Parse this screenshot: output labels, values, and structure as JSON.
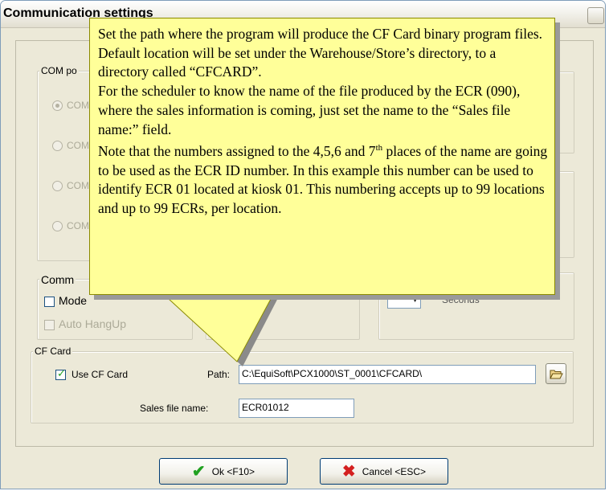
{
  "window": {
    "title": "Communication settings"
  },
  "com_port": {
    "legend": "COM po",
    "options": [
      "COM",
      "COM",
      "COM",
      "COM"
    ]
  },
  "comm": {
    "legend": "Comm",
    "modem_label": "Mode",
    "auto_hangup_label": "Auto HangUp"
  },
  "timeout": {
    "value": "",
    "unit_label": "Seconds"
  },
  "cf_card": {
    "legend": "CF Card",
    "use_label": "Use CF Card",
    "use_checked": true,
    "path_label": "Path:",
    "path_value": "C:\\EquiSoft\\PCX1000\\ST_0001\\CFCARD\\",
    "sales_label": "Sales file name:",
    "sales_value": "ECR01012"
  },
  "buttons": {
    "ok": "Ok <F10>",
    "cancel": "Cancel <ESC>"
  },
  "tooltip": {
    "p1": "Set the path where the program will produce the CF Card binary program files. Default location will be set under the Warehouse/Store’s directory, to a directory called “CFCARD”.",
    "p2": "For the scheduler to know the name of the file produced by the ECR (090), where the sales information is coming, just set the name to the “Sales file name:” field.",
    "p3a": "Note that the numbers assigned to the 4,5,6 and 7",
    "p3sup": "th",
    "p3b": " places of the name are going to be used as the ECR ID number. In this example this number can be used to identify ECR 01 located at kiosk 01. This numbering accepts up to 99 locations and up to 99 ECRs, per location."
  },
  "colors": {
    "tooltip_bg": "#ffff99",
    "window_bg": "#ece9d8",
    "ok_check": "#21a121",
    "cancel_x": "#d42020"
  }
}
